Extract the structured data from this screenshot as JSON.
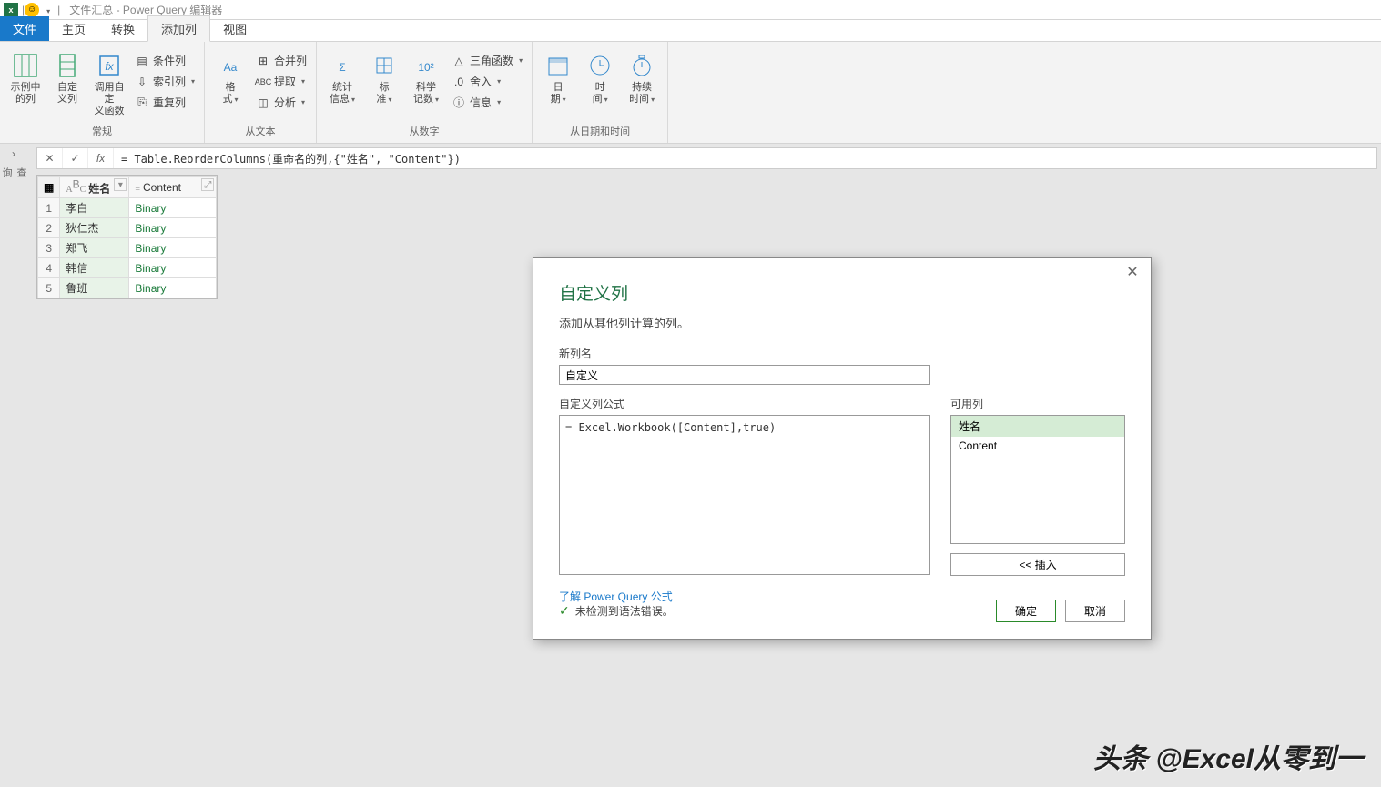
{
  "title": "文件汇总 - Power Query 编辑器",
  "tabs": {
    "file": "文件",
    "home": "主页",
    "transform": "转换",
    "addcol": "添加列",
    "view": "视图"
  },
  "ribbon": {
    "g1": {
      "label": "常规",
      "btn1": "示例中\n的列",
      "btn2": "自定\n义列",
      "btn3": "调用自定\n义函数",
      "s1": "条件列",
      "s2": "索引列",
      "s3": "重复列"
    },
    "g2": {
      "label": "从文本",
      "btn1": "格\n式",
      "s1": "合并列",
      "s2": "提取",
      "s3": "分析"
    },
    "g3": {
      "label": "从数字",
      "btn1": "统计\n信息",
      "btn2": "标\n准",
      "btn3": "科学\n记数",
      "s1": "三角函数",
      "s2": "舍入",
      "s3": "信息"
    },
    "g4": {
      "label": "从日期和时间",
      "btn1": "日\n期",
      "btn2": "时\n间",
      "btn3": "持续\n时间"
    }
  },
  "formula": "= Table.ReorderColumns(重命名的列,{\"姓名\", \"Content\"})",
  "rail": "查询",
  "grid": {
    "col1": "姓名",
    "col2": "Content",
    "rows": [
      {
        "n": "1",
        "name": "李白",
        "content": "Binary"
      },
      {
        "n": "2",
        "name": "狄仁杰",
        "content": "Binary"
      },
      {
        "n": "3",
        "name": "郑飞",
        "content": "Binary"
      },
      {
        "n": "4",
        "name": "韩信",
        "content": "Binary"
      },
      {
        "n": "5",
        "name": "鲁班",
        "content": "Binary"
      }
    ]
  },
  "dialog": {
    "title": "自定义列",
    "desc": "添加从其他列计算的列。",
    "newcol_label": "新列名",
    "newcol_value": "自定义",
    "formula_label": "自定义列公式",
    "formula_value": "= Excel.Workbook([Content],true)",
    "avail_label": "可用列",
    "avail_items": [
      "姓名",
      "Content"
    ],
    "insert": "<< 插入",
    "learn": "了解 Power Query 公式",
    "status": "未检测到语法错误。",
    "ok": "确定",
    "cancel": "取消"
  },
  "watermark": "头条 @Excel从零到一"
}
